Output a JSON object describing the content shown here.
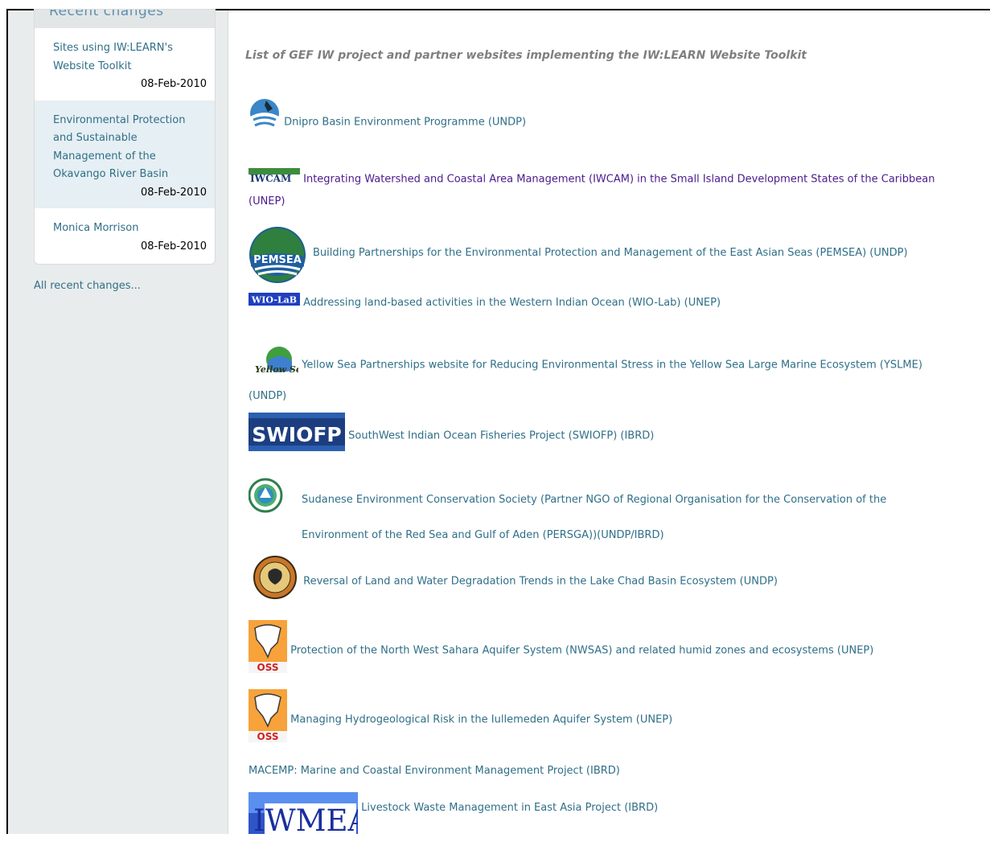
{
  "sidebar": {
    "heading": "Recent changes",
    "items": [
      {
        "title": "Sites using IW:LEARN's Website Toolkit",
        "date": "08-Feb-2010"
      },
      {
        "title": "Environmental Protection and Sustainable Management of the Okavango River Basin",
        "date": "08-Feb-2010"
      },
      {
        "title": "Monica Morrison",
        "date": "08-Feb-2010"
      }
    ],
    "all_recent": "All recent changes..."
  },
  "main": {
    "title": "List of GEF IW project and partner websites implementing the IW:LEARN Website Toolkit",
    "projects": [
      {
        "text": "Dnipro Basin Environment Programme (UNDP)",
        "logo": "dnipro-logo"
      },
      {
        "text": "Integrating Watershed and Coastal Area Management (IWCAM) in the Small Island Development States of the Caribbean (UNEP)",
        "logo": "iwcam-logo",
        "logo_text": "IWCAM"
      },
      {
        "text": "Building Partnerships for the Environmental Protection and Management of the East Asian Seas (PEMSEA) (UNDP)",
        "logo": "pemsea-logo",
        "logo_text": "PEMSEA"
      },
      {
        "text": "Addressing land-based activities in the Western Indian Ocean (WIO-Lab)  (UNEP)",
        "logo": "wio-lab-logo",
        "logo_text": "WIO-LaB"
      },
      {
        "text": "Yellow Sea Partnerships website for Reducing Environmental Stress in the Yellow Sea Large Marine Ecosystem (YSLME) (UNDP)",
        "logo": "yellow-sea-logo",
        "logo_text": "Yellow Sea"
      },
      {
        "text": "SouthWest Indian Ocean Fisheries Project (SWIOFP) (IBRD)",
        "logo": "swiofp-logo",
        "logo_text": "SWIOFP"
      },
      {
        "text": "Sudanese Environment Conservation Society (Partner NGO of Regional Organisation for the Conservation of the Environment of the Red Sea and Gulf of Aden (PERSGA))(UNDP/IBRD)",
        "logo": "persga-logo"
      },
      {
        "text": "Reversal of Land and Water Degradation Trends in the Lake Chad Basin Ecosystem (UNDP)",
        "logo": "lake-chad-logo"
      },
      {
        "text": "Protection of the North West Sahara Aquifer System (NWSAS) and related humid zones and ecosystems (UNEP)",
        "logo": "oss-logo",
        "logo_text": "OSS"
      },
      {
        "text": "Managing Hydrogeological Risk in the Iullemeden Aquifer System (UNEP)",
        "logo": "oss-logo",
        "logo_text": "OSS"
      },
      {
        "text": "MACEMP: Marine and Coastal Environment Management Project (IBRD)",
        "logo": ""
      },
      {
        "text": "Livestock Waste Management in East Asia Project (IBRD)",
        "logo": "iwmea-logo",
        "logo_text": "IWMEA"
      }
    ]
  },
  "colors": {
    "link": "#2f6f88",
    "visited_link": "#4a1a8c",
    "sidebar_bg": "#e9ecec",
    "highlight_bg": "#e6eff3",
    "heading_gray": "#7f7f7f"
  }
}
